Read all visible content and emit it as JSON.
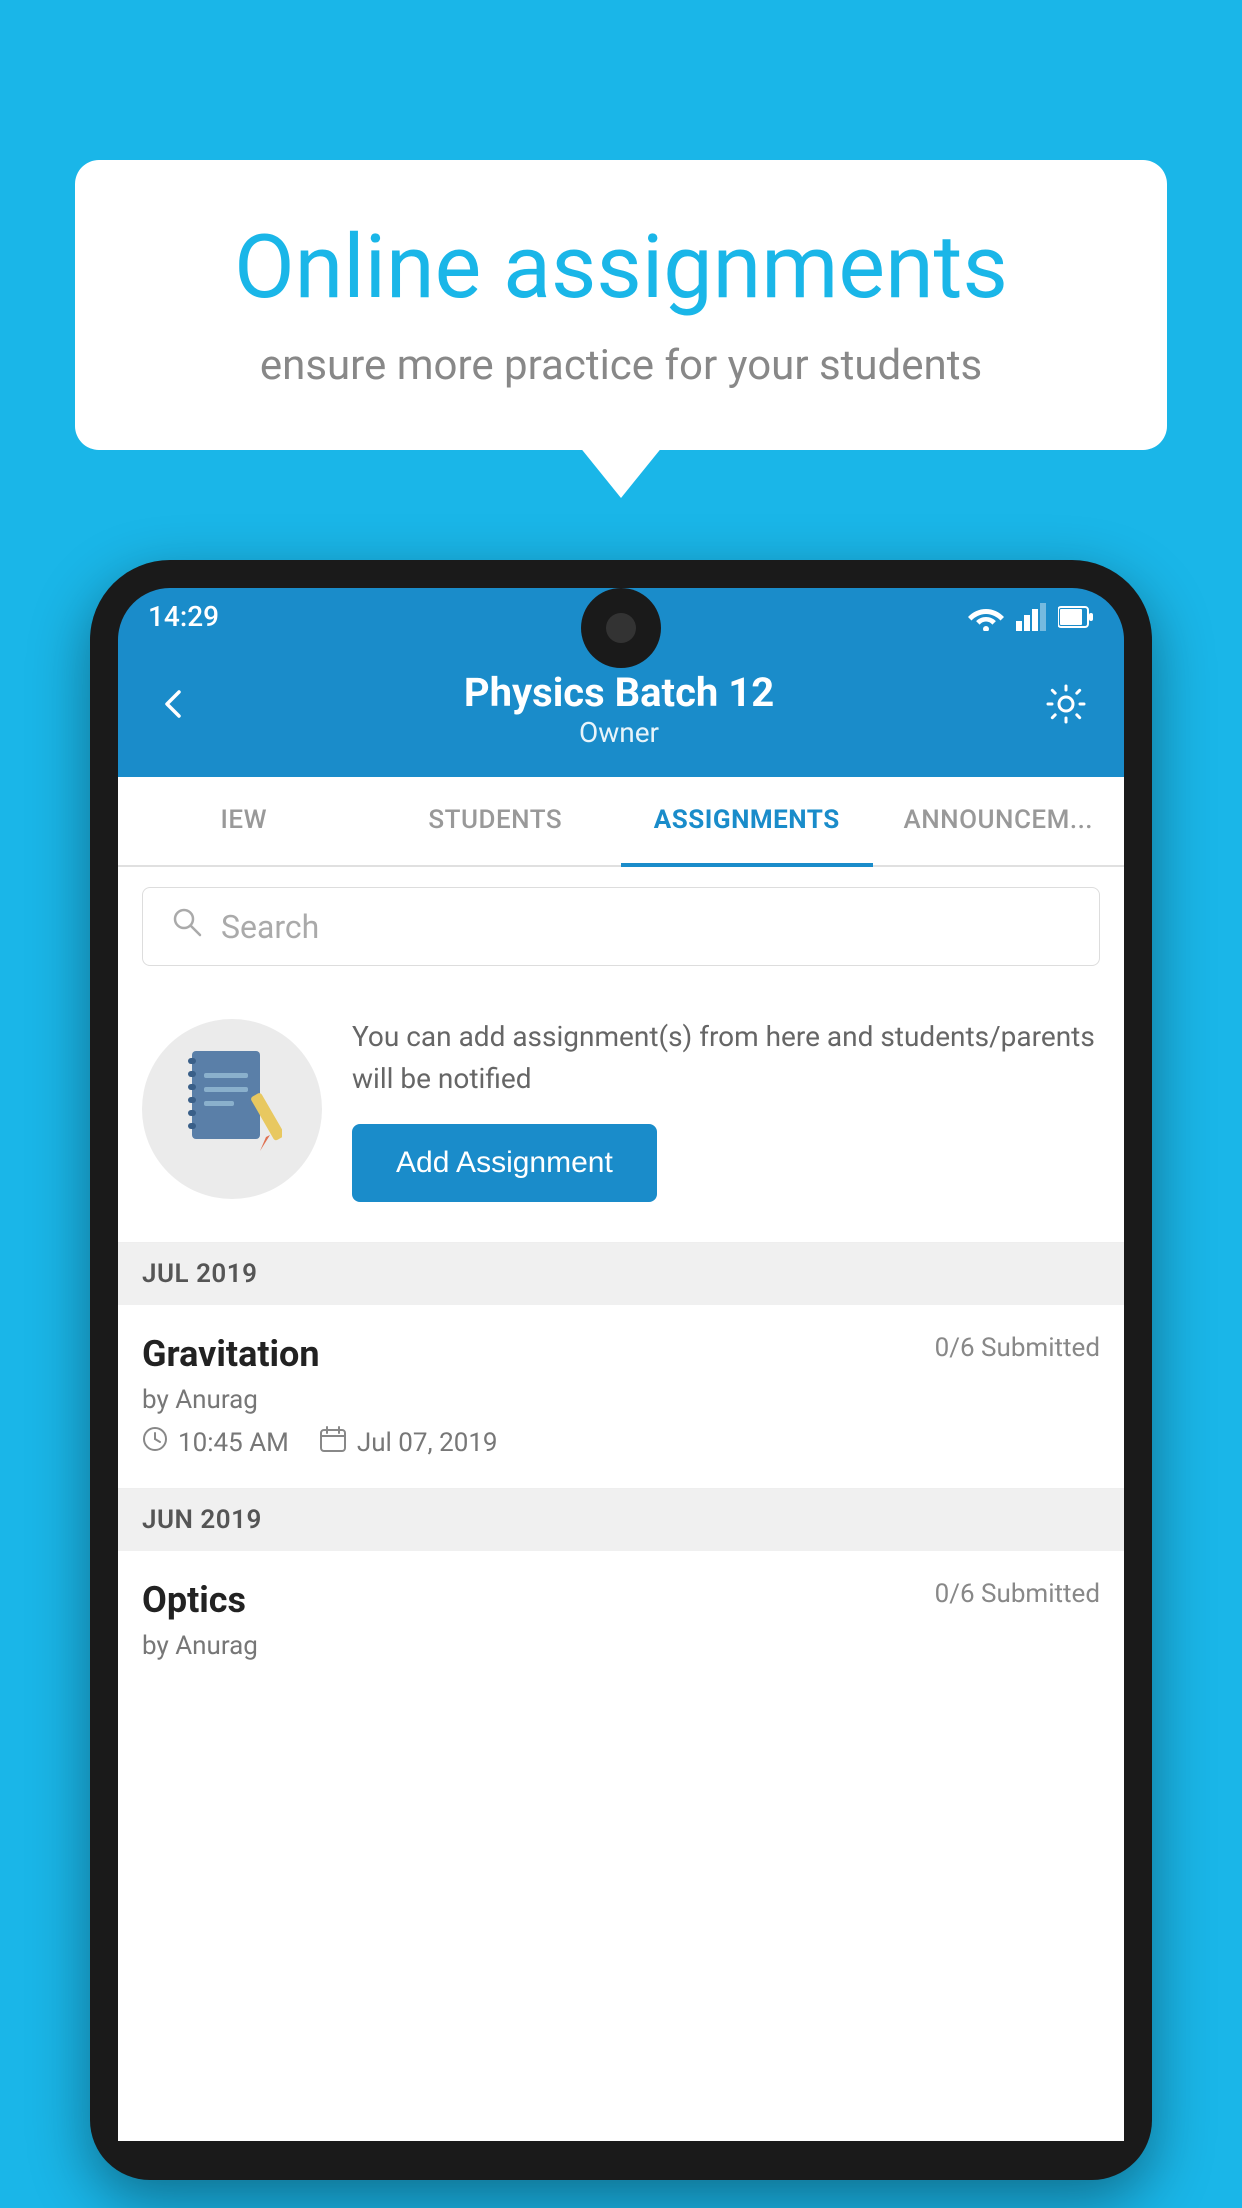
{
  "background_color": "#1ab6e8",
  "speech_bubble": {
    "title": "Online assignments",
    "subtitle": "ensure more practice for your students"
  },
  "phone": {
    "status_bar": {
      "time": "14:29",
      "wifi": true,
      "signal": true,
      "battery": true
    },
    "header": {
      "title": "Physics Batch 12",
      "subtitle": "Owner",
      "back_label": "back",
      "settings_label": "settings"
    },
    "tabs": [
      {
        "id": "overview",
        "label": "IEW",
        "active": false
      },
      {
        "id": "students",
        "label": "STUDENTS",
        "active": false
      },
      {
        "id": "assignments",
        "label": "ASSIGNMENTS",
        "active": true
      },
      {
        "id": "announcements",
        "label": "ANNOUNCEM...",
        "active": false
      }
    ],
    "search": {
      "placeholder": "Search"
    },
    "add_assignment_section": {
      "description": "You can add assignment(s) from here and students/parents will be notified",
      "button_label": "Add Assignment"
    },
    "sections": [
      {
        "id": "jul2019",
        "header": "JUL 2019",
        "items": [
          {
            "name": "Gravitation",
            "submitted": "0/6 Submitted",
            "by": "by Anurag",
            "time": "10:45 AM",
            "date": "Jul 07, 2019"
          }
        ]
      },
      {
        "id": "jun2019",
        "header": "JUN 2019",
        "items": [
          {
            "name": "Optics",
            "submitted": "0/6 Submitted",
            "by": "by Anurag",
            "time": "",
            "date": ""
          }
        ]
      }
    ]
  }
}
